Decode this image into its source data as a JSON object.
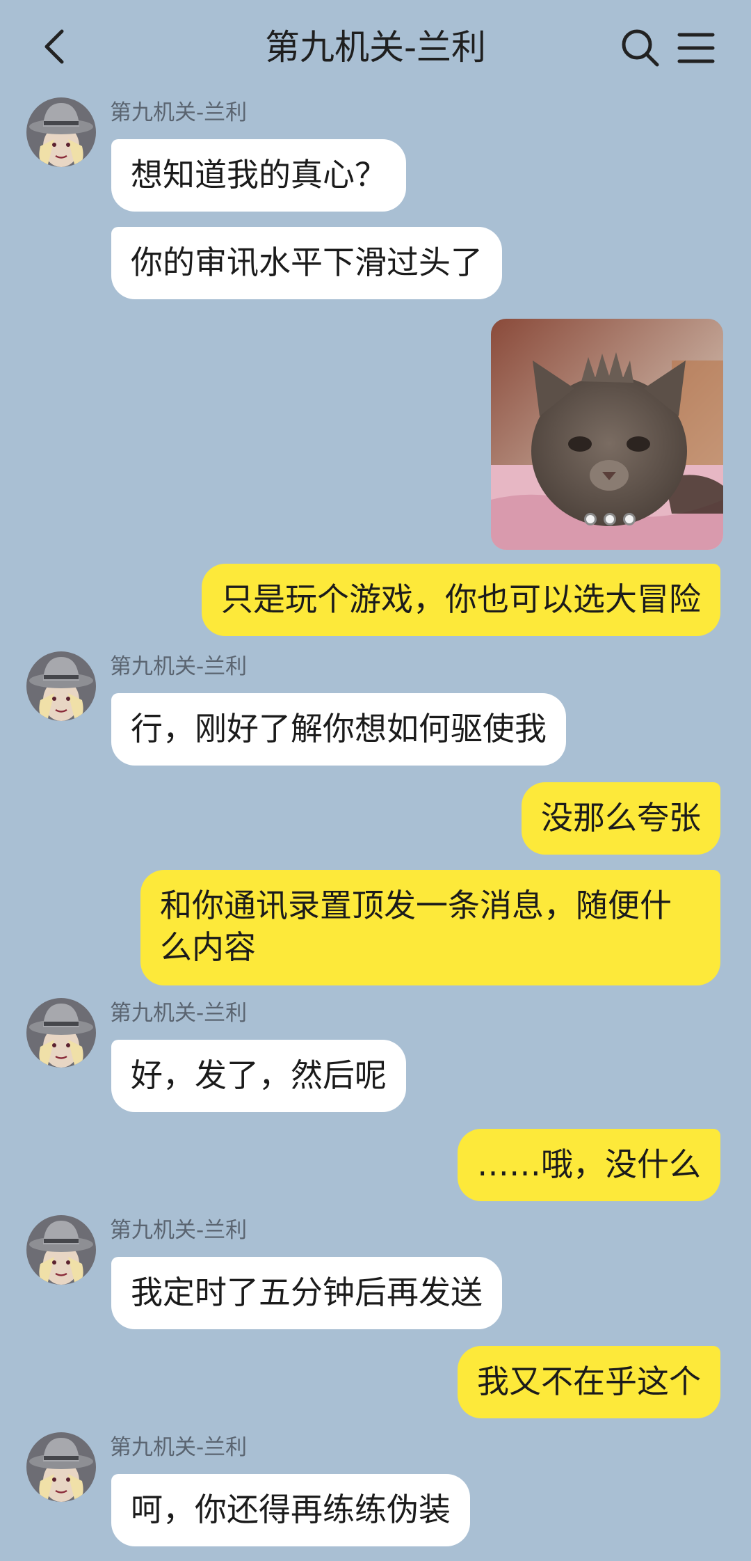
{
  "header": {
    "title": "第九机关-兰利",
    "back_icon": "chevron-left-icon",
    "search_icon": "search-icon",
    "menu_icon": "menu-icon"
  },
  "colors": {
    "background": "#a9bfd3",
    "incoming_bubble": "#ffffff",
    "outgoing_bubble": "#fde93a"
  },
  "messages": [
    {
      "sender": "第九机关-兰利",
      "text": "想知道我的真心？"
    },
    {
      "text": "你的审讯水平下滑过头了"
    },
    {
      "type": "image",
      "description_icon": "photo-kitten"
    },
    {
      "text": "只是玩个游戏，你也可以选大冒险"
    },
    {
      "sender": "第九机关-兰利",
      "text": "行，刚好了解你想如何驱使我"
    },
    {
      "text": "没那么夸张"
    },
    {
      "text": "和你通讯录置顶发一条消息，随便什么内容"
    },
    {
      "sender": "第九机关-兰利",
      "text": "好，发了，然后呢"
    },
    {
      "text": "……哦，没什么"
    },
    {
      "sender": "第九机关-兰利",
      "text": "我定时了五分钟后再发送"
    },
    {
      "text": "我又不在乎这个"
    },
    {
      "sender": "第九机关-兰利",
      "text": "呵，你还得再练练伪装"
    }
  ]
}
